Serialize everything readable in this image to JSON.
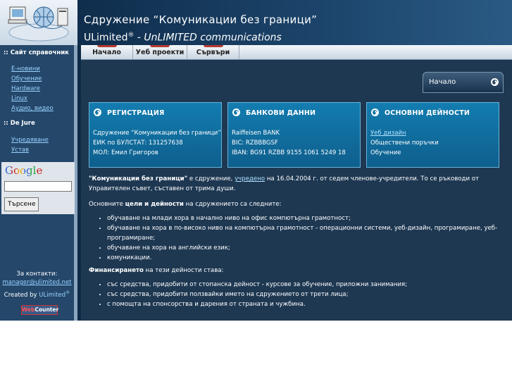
{
  "header": {
    "title": "Сдружение “Комуникации без граници”",
    "subtitle_brand": "ULimited",
    "subtitle_reg": "®",
    "subtitle_dash": " - ",
    "subtitle_slogan": "UnLIMITED communications"
  },
  "sidebar": {
    "section1_heading": ":: Сайт справочник",
    "section1_links": [
      "Е-новини",
      "Обучение",
      "Hardware",
      "Linux",
      "Аудио, видео"
    ],
    "section2_heading": ":: De Jure",
    "section2_links": [
      "Учредяване",
      "Устав"
    ],
    "google_logo": "Google",
    "search_button": "Търсене",
    "search_value": "",
    "contact_label": "За контакти:",
    "contact_email": "manager@ulimited.net",
    "created_by": "Created by ",
    "created_brand": "ULimited",
    "created_reg": "®",
    "counter_web": "Web",
    "counter_counter": "Counter"
  },
  "nav": {
    "tabs": [
      "Начало",
      "Уеб проекти",
      "Сървъри"
    ]
  },
  "breadcrumb": "Начало",
  "boxes": [
    {
      "title": "РЕГИСТРАЦИЯ",
      "lines": [
        "Сдружение “Комуникации без граници”",
        "ЕИК по БУЛСТАТ: 131257638",
        "МОЛ: Емил Григоров"
      ]
    },
    {
      "title": "БАНКОВИ ДАННИ",
      "lines": [
        "Raiffeisen BANK",
        "BIC: RZBBBGSF",
        "IBAN: BG91 RZBB 9155 1061 5249 18"
      ]
    },
    {
      "title": "ОСНОВНИ ДЕЙНОСТИ",
      "link": "Уеб дизайн",
      "lines": [
        "Обществени поръчки",
        "Обучение"
      ]
    }
  ],
  "article": {
    "intro_bold": "\"Комуникации без граници\"",
    "intro_text1": " е сдружение, ",
    "intro_link": "учредено",
    "intro_text2": " на 16.04.2004 г. от седем членове-учредители. То се ръководи от Управителен съвет, съставен от трима души.",
    "goals_pre": "Основните ",
    "goals_bold": "цели и дейности",
    "goals_post": " на сдружението са следните:",
    "goals": [
      "обучаване на млади хора в начално ниво на офис компютърна грамотност;",
      "обучаване на хора в по-високо ниво на компютърна грамотност - операционни системи, уеб-дизайн, програмиране, уеб-програмиране;",
      "обучаване на хора на английски език;",
      "комуникации."
    ],
    "finance_bold": "Финансирането",
    "finance_post": " на тези дейности става:",
    "finance": [
      "със средства, придобити от стопанска дейност - курсове за обучение, приложни занимания;",
      "със средства, придобити ползвайки името на сдружението от трети лица;",
      "с помощта на спонсорства и дарения от страната и чужбина."
    ]
  },
  "colors": {
    "page_bg": "#1e3852",
    "sidebar_bg": "#24476a",
    "box_bg": "#137cb0",
    "link": "#aee1ff",
    "tab_accent": "#b53a2f"
  }
}
